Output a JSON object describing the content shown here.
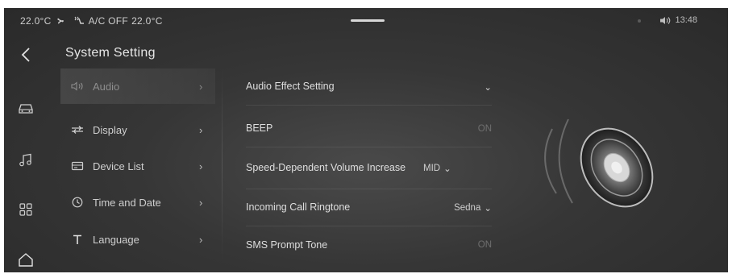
{
  "status_bar": {
    "left_temp": "22.0°C",
    "ac_status": "A/C OFF",
    "right_temp": "22.0°C",
    "time": "13:48",
    "fan_icon": "fan-icon",
    "seat_icon": "seat-heat-icon",
    "volume_icon": "speaker-volume-icon"
  },
  "page": {
    "title": "System Setting",
    "back_icon": "back-arrow-icon"
  },
  "rail": [
    {
      "icon": "car-icon"
    },
    {
      "icon": "music-icon"
    },
    {
      "icon": "apps-grid-icon"
    },
    {
      "icon": "home-icon"
    }
  ],
  "menu": {
    "items": [
      {
        "label": "Audio",
        "icon": "speaker-icon",
        "active": true
      },
      {
        "label": "Display",
        "icon": "sliders-icon"
      },
      {
        "label": "Device List",
        "icon": "device-icon"
      },
      {
        "label": "Time and Date",
        "icon": "clock-icon"
      },
      {
        "label": "Language",
        "icon": "text-t-icon"
      }
    ]
  },
  "settings": {
    "rows": [
      {
        "label": "Audio Effect Setting",
        "value": "",
        "dropdown": true
      },
      {
        "label": "BEEP",
        "value": "ON",
        "dim": true
      },
      {
        "label": "Speed-Dependent Volume Increase",
        "value": "MID",
        "dropdown": true
      },
      {
        "label": "Incoming Call Ringtone",
        "value": "Sedna",
        "dropdown": true
      },
      {
        "label": "SMS Prompt Tone",
        "value": "ON",
        "dim": true
      }
    ]
  },
  "colors": {
    "background": "#363636",
    "text": "#d6d6d6",
    "dim_text": "#6f6f6f"
  }
}
